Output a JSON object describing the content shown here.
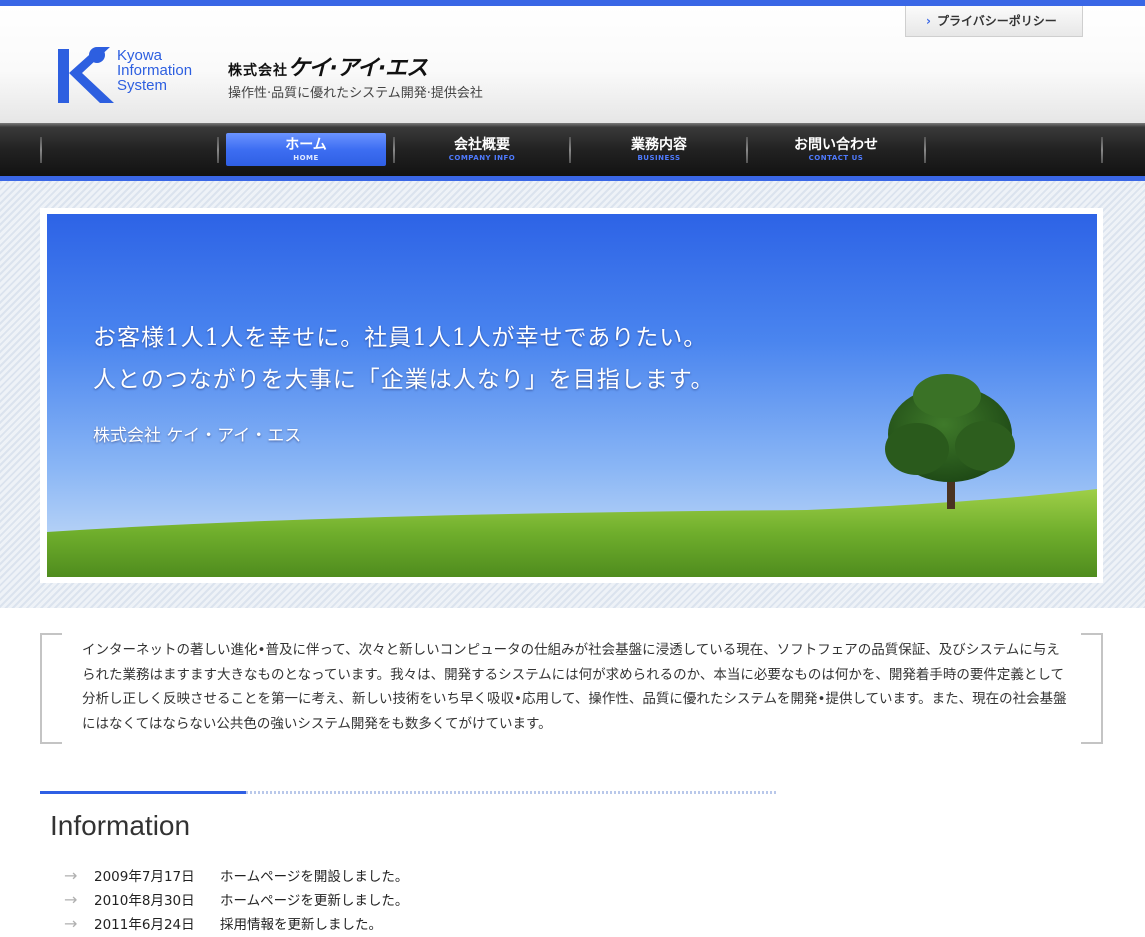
{
  "header": {
    "logo_words": [
      "Kyowa",
      "Information",
      "System"
    ],
    "company_prefix": "株式会社",
    "company_name": "ケイ·アイ·エス",
    "tagline": "操作性·品質に優れたシステム開発·提供会社",
    "privacy_link": "プライバシーポリシー"
  },
  "nav": {
    "items": [
      {
        "label": "ホーム",
        "sub": "HOME",
        "active": true
      },
      {
        "label": "会社概要",
        "sub": "COMPANY INFO",
        "active": false
      },
      {
        "label": "業務内容",
        "sub": "BUSINESS",
        "active": false
      },
      {
        "label": "お問い合わせ",
        "sub": "CONTACT US",
        "active": false
      }
    ]
  },
  "hero": {
    "line1": "お客様1人1人を幸せに。社員1人1人が幸せでありたい。",
    "line2": "人とのつながりを大事に「企業は人なり」を目指します。",
    "signature": "株式会社 ケイ・アイ・エス"
  },
  "intro": {
    "text": "インターネットの著しい進化•普及に伴って、次々と新しいコンピュータの仕組みが社会基盤に浸透している現在、ソフトフェアの品質保証、及びシステムに与えられた業務はますます大きなものとなっています。我々は、開発するシステムには何が求められるのか、本当に必要なものは何かを、開発着手時の要件定義として分析し正しく反映させることを第一に考え、新しい技術をいち早く吸収•応用して、操作性、品質に優れたシステムを開発•提供しています。また、現在の社会基盤にはなくてはならない公共色の強いシステム開発をも数多くてがけています。"
  },
  "information": {
    "title": "Information",
    "items": [
      {
        "date": "2009年7月17日",
        "text": "ホームページを開設しました。"
      },
      {
        "date": "2010年8月30日",
        "text": "ホームページを更新しました。"
      },
      {
        "date": "2011年6月24日",
        "text": "採用情報を更新しました。"
      }
    ]
  },
  "colors": {
    "accent": "#3a67e6",
    "nav_dark": "#222222",
    "logo_blue": "#2d5fe0"
  }
}
